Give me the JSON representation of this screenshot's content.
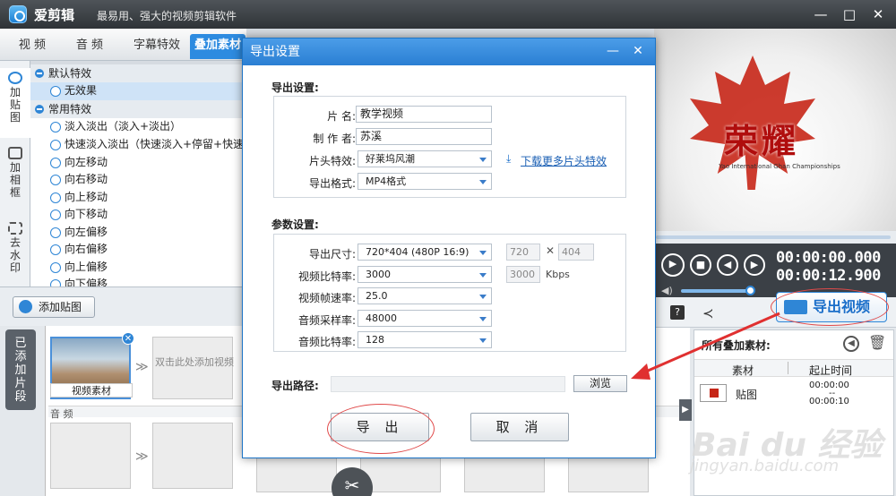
{
  "app": {
    "name": "爱剪辑",
    "slogan": "最易用、强大的视频剪辑软件",
    "window_controls": [
      "—",
      "□",
      "✕"
    ]
  },
  "tabs": [
    "视 频",
    "音 频",
    "字幕特效",
    "叠加素材"
  ],
  "side_tabs": [
    "加贴图",
    "加相框",
    "去水印"
  ],
  "effects": {
    "groups": [
      {
        "name": "默认特效",
        "items": [
          "无效果"
        ]
      },
      {
        "name": "常用特效",
        "items": [
          "淡入淡出（淡入+淡出）",
          "快速淡入淡出（快速淡入+停留+快速淡",
          "向左移动",
          "向右移动",
          "向上移动",
          "向下移动",
          "向左偏移",
          "向右偏移",
          "向上偏移",
          "向下偏移"
        ]
      }
    ],
    "selected": "无效果"
  },
  "add_sticker_label": "添加贴图",
  "timeline": {
    "side_label": "已添加片段",
    "clip_label": "视频素材",
    "add_hint": "双击此处添加视频",
    "audio_label": "音 频",
    "arrow": "≫"
  },
  "preview": {
    "logo_text": "荣耀",
    "logo_caption": "Yao International Ghan Championships",
    "time_current": "00:00:00.000",
    "time_total": "00:00:12.900"
  },
  "export_video_label": "导出视频",
  "overlay_panel": {
    "title": "所有叠加素材:",
    "col_material": "素材",
    "col_time": "起止时间",
    "row": {
      "name": "贴图",
      "start": "00:00:00",
      "sep": "--",
      "end": "00:00:10"
    }
  },
  "dialog": {
    "title": "导出设置",
    "section_export": "导出设置:",
    "fields": {
      "film_name_label": "片 名:",
      "film_name": "教学视频",
      "author_label": "制 作 者:",
      "author": "苏溪",
      "intro_label": "片头特效:",
      "intro": "好莱坞风潮",
      "download_link": "下载更多片头特效",
      "format_label": "导出格式:",
      "format": "MP4格式"
    },
    "section_params": "参数设置:",
    "params": {
      "size_label": "导出尺寸:",
      "size": "720*404 (480P 16:9)",
      "width": "720",
      "height": "404",
      "times": "✕",
      "vbitrate_label": "视频比特率:",
      "vbitrate": "3000",
      "vbitrate_custom": "3000",
      "kbps": "Kbps",
      "fps_label": "视频帧速率:",
      "fps": "25.0",
      "asample_label": "音频采样率:",
      "asample": "48000",
      "abitrate_label": "音频比特率:",
      "abitrate": "128"
    },
    "path_label": "导出路径:",
    "browse": "浏览",
    "export_btn": "导 出",
    "cancel_btn": "取 消",
    "minimize": "—",
    "close": "✕"
  },
  "watermark": {
    "line1": "Bai du 经验",
    "line2": "jingyan.baidu.com"
  }
}
